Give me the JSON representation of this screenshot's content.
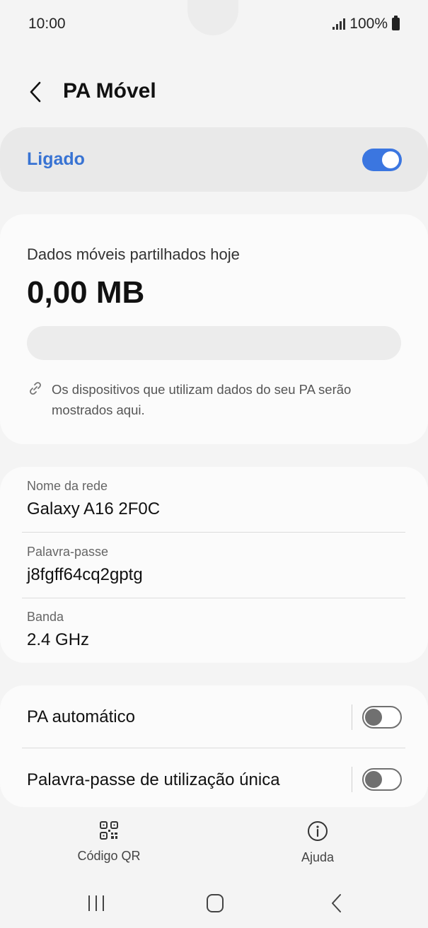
{
  "status_bar": {
    "time": "10:00",
    "battery": "100%"
  },
  "header": {
    "title": "PA Móvel"
  },
  "master_switch": {
    "label": "Ligado",
    "state": "on"
  },
  "data_usage": {
    "label": "Dados móveis partilhados hoje",
    "value": "0,00 MB",
    "fraction_used": 0,
    "note": "Os dispositivos que utilizam dados do seu PA serão mostrados aqui."
  },
  "network": {
    "name_label": "Nome da rede",
    "name_value": "Galaxy A16 2F0C",
    "password_label": "Palavra-passe",
    "password_value": "j8fgff64cq2gptg",
    "band_label": "Banda",
    "band_value": "2.4 GHz"
  },
  "options": {
    "auto_hotspot_label": "PA automático",
    "auto_hotspot_state": "off",
    "one_time_password_label": "Palavra-passe de utilização única",
    "one_time_password_state": "off"
  },
  "bottom_actions": {
    "qr_label": "Código QR",
    "help_label": "Ajuda"
  },
  "colors": {
    "accent": "#3b76e0",
    "accent_text": "#3873d3",
    "background": "#f4f4f4",
    "card": "#fbfbfb"
  },
  "icons": [
    "back-chevron-icon",
    "link-icon",
    "qr-code-icon",
    "info-icon",
    "recents-icon",
    "home-icon",
    "back-icon",
    "signal-icon",
    "battery-icon"
  ]
}
